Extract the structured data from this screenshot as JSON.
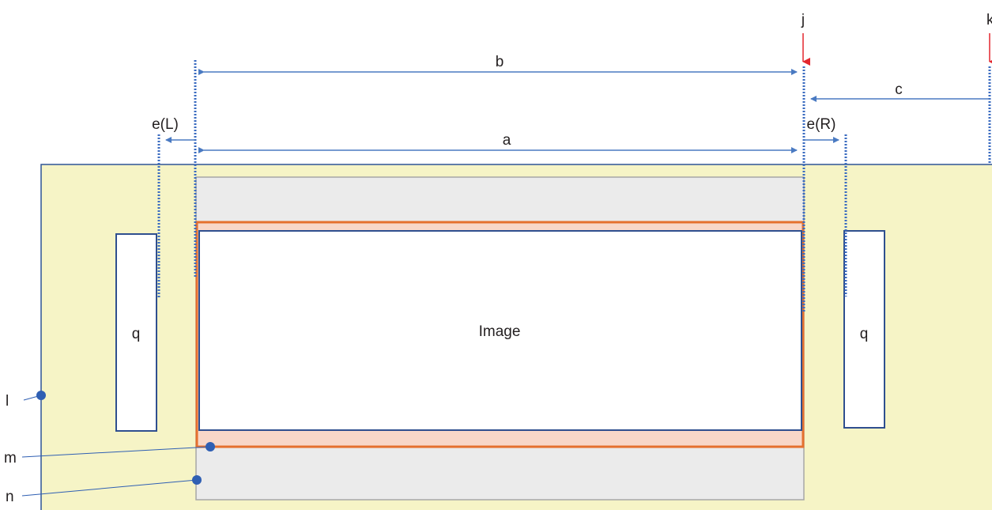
{
  "labels": {
    "a": "a",
    "b": "b",
    "c": "c",
    "e_left": "e(L)",
    "e_right": "e(R)",
    "j": "j",
    "k": "k",
    "image": "Image",
    "q_left": "q",
    "q_right": "q",
    "l": "l",
    "m": "m",
    "n": "n"
  },
  "colors": {
    "outer_fill": "#f6f4c6",
    "outer_stroke": "#2f5496",
    "gray_fill": "#ebebeb",
    "gray_stroke": "#a6a6a6",
    "orange_fill": "#f8d7c8",
    "orange_stroke": "#e5702e",
    "dimension_line": "#4a7ac2",
    "dotted_guide": "#3a6bc0",
    "marker_arrow": "#e3262e",
    "callout_dot": "#2f5fb3",
    "text": "#231f20"
  }
}
